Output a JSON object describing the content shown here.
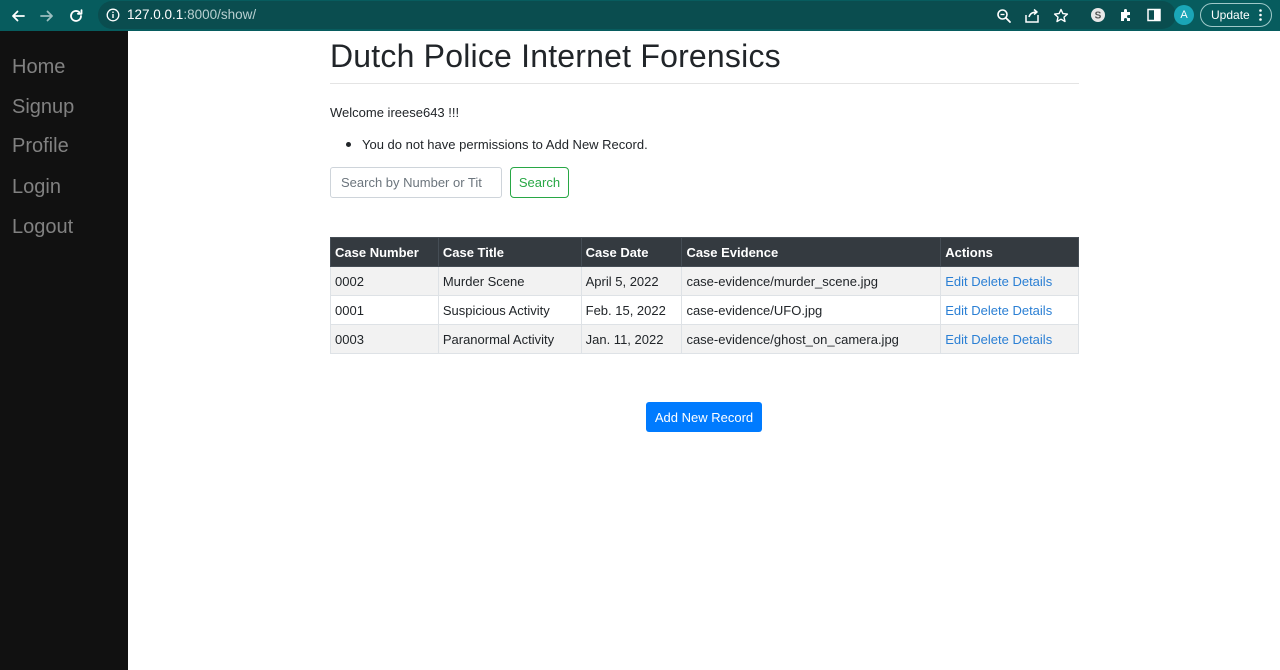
{
  "browser": {
    "url_host": "127.0.0.1",
    "url_path": ":8000/show/",
    "avatar_letter": "A",
    "update_label": "Update",
    "icons": [
      "back-icon",
      "forward-icon",
      "reload-icon",
      "site-info-icon",
      "zoom-icon",
      "share-icon",
      "bookmark-star-icon",
      "skype-extension-icon",
      "extensions-puzzle-icon",
      "side-panel-icon",
      "menu-dots-icon"
    ]
  },
  "sidebar": {
    "items": [
      {
        "label": "Home"
      },
      {
        "label": "Signup"
      },
      {
        "label": "Profile"
      },
      {
        "label": "Login"
      },
      {
        "label": "Logout"
      }
    ]
  },
  "main": {
    "title": "Dutch Police Internet Forensics",
    "welcome": "Welcome ireese643 !!!",
    "message": "You do not have permissions to Add New Record.",
    "search": {
      "placeholder": "Search by Number or Tit",
      "button_label": "Search"
    },
    "table": {
      "headers": [
        "Case Number",
        "Case Title",
        "Case Date",
        "Case Evidence",
        "Actions"
      ],
      "rows": [
        {
          "number": "0002",
          "title": "Murder Scene",
          "date": "April 5, 2022",
          "evidence": "case-evidence/murder_scene.jpg"
        },
        {
          "number": "0001",
          "title": "Suspicious Activity",
          "date": "Feb. 15, 2022",
          "evidence": "case-evidence/UFO.jpg"
        },
        {
          "number": "0003",
          "title": "Paranormal Activity",
          "date": "Jan. 11, 2022",
          "evidence": "case-evidence/ghost_on_camera.jpg"
        }
      ],
      "actions": {
        "edit": "Edit",
        "delete": "Delete",
        "details": "Details"
      }
    },
    "add_button_label": "Add New Record"
  },
  "colors": {
    "browser_bar": "#075c5e",
    "sidebar_bg": "#111111",
    "sidebar_link": "#818181",
    "table_header": "#343a40",
    "search_button": "#28a745",
    "primary_button": "#007bff",
    "link": "#2a7fd4"
  }
}
